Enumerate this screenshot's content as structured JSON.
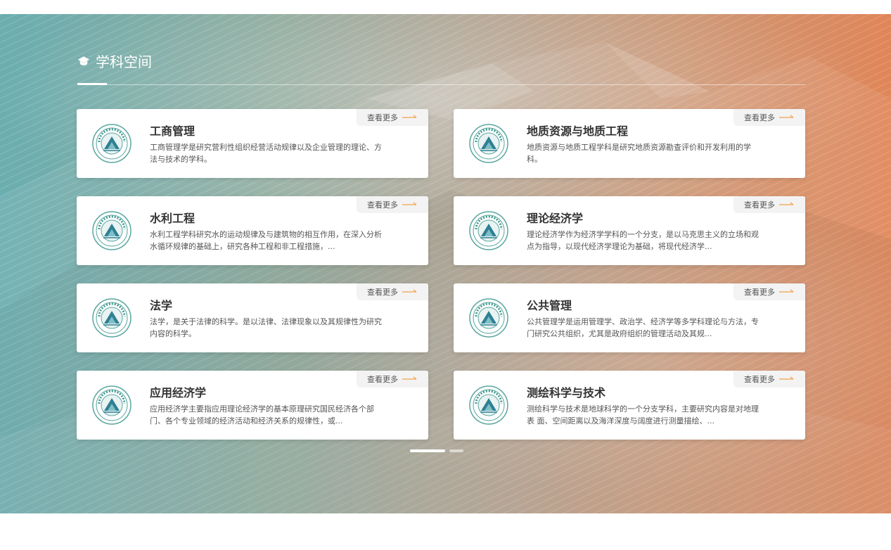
{
  "section": {
    "title": "学科空间"
  },
  "more_label": "查看更多",
  "colors": {
    "accent": "#f0a24d",
    "banner_left": "#6fb3b5",
    "banner_right": "#e68a5c"
  },
  "disciplines": [
    {
      "name": "工商管理",
      "desc": "工商管理学是研究营利性组织经营活动规律以及企业管理的理论、方法与技术的学科。"
    },
    {
      "name": "地质资源与地质工程",
      "desc": "地质资源与地质工程学科是研究地质资源勘查评价和开发利用的学科。"
    },
    {
      "name": "水利工程",
      "desc": "水利工程学科研究水的运动规律及与建筑物的相互作用，在深入分析水循环规律的基础上，研究各种工程和非工程措施，..."
    },
    {
      "name": "理论经济学",
      "desc": "理论经济学作为经济学学科的一个分支，是以马克思主义的立场和观点为指导，以现代经济学理论为基础，将现代经济学..."
    },
    {
      "name": "法学",
      "desc": "法学，是关于法律的科学。是以法律、法律现象以及其规律性为研究内容的科学。"
    },
    {
      "name": "公共管理",
      "desc": "公共管理学是运用管理学、政治学、经济学等多学科理论与方法，专门研究公共组织，尤其是政府组织的管理活动及其规..."
    },
    {
      "name": "应用经济学",
      "desc": "应用经济学主要指应用理论经济学的基本原理研究国民经济各个部门、各个专业领域的经济活动和经济关系的规律性，或..."
    },
    {
      "name": "测绘科学与技术",
      "desc": "测绘科学与技术是地球科学的一个分支学科，主要研究内容是对地理表 面、空间距离以及海洋深度与阔度进行测量描绘、..."
    }
  ],
  "pagination": {
    "pages": 2,
    "current": 1
  }
}
